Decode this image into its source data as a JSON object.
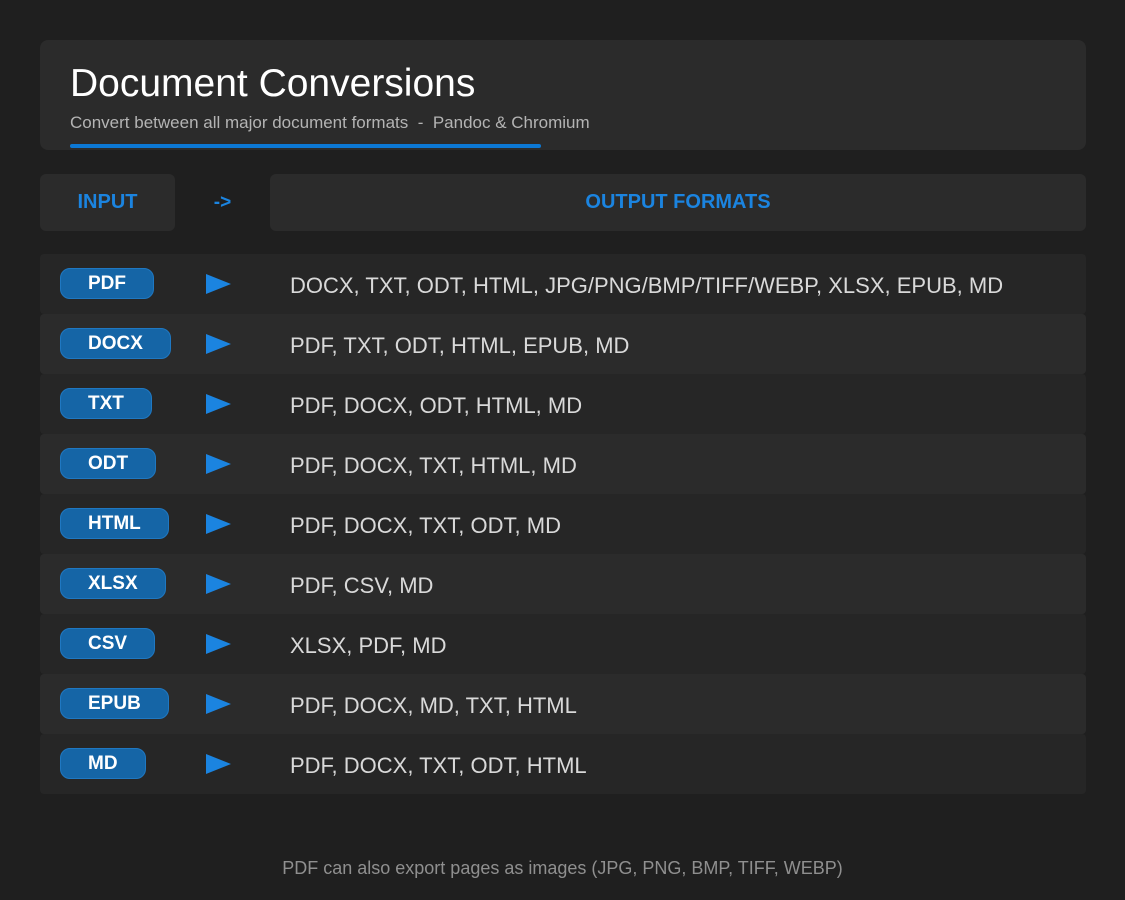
{
  "header": {
    "title": "Document Conversions",
    "subtitle": "Convert between all major document formats  -  Pandoc & Chromium",
    "accent_color": "#0c78d4"
  },
  "table_header": {
    "input_label": "INPUT",
    "arrow_label": "->",
    "output_label": "OUTPUT FORMATS"
  },
  "rows": [
    {
      "input": "PDF",
      "outputs": "DOCX, TXT, ODT, HTML, JPG/PNG/BMP/TIFF/WEBP, XLSX, EPUB, MD",
      "arrow_icon": "play-triangle-icon"
    },
    {
      "input": "DOCX",
      "outputs": "PDF, TXT, ODT, HTML, EPUB, MD",
      "arrow_icon": "play-triangle-icon"
    },
    {
      "input": "TXT",
      "outputs": "PDF, DOCX, ODT, HTML, MD",
      "arrow_icon": "play-triangle-icon"
    },
    {
      "input": "ODT",
      "outputs": "PDF, DOCX, TXT, HTML, MD",
      "arrow_icon": "play-triangle-icon"
    },
    {
      "input": "HTML",
      "outputs": "PDF, DOCX, TXT, ODT, MD",
      "arrow_icon": "play-triangle-icon"
    },
    {
      "input": "XLSX",
      "outputs": "PDF, CSV, MD",
      "arrow_icon": "play-triangle-icon"
    },
    {
      "input": "CSV",
      "outputs": "XLSX, PDF, MD",
      "arrow_icon": "play-triangle-icon"
    },
    {
      "input": "EPUB",
      "outputs": "PDF, DOCX, MD, TXT, HTML",
      "arrow_icon": "play-triangle-icon"
    },
    {
      "input": "MD",
      "outputs": "PDF, DOCX, TXT, ODT, HTML",
      "arrow_icon": "play-triangle-icon"
    }
  ],
  "footer": {
    "note": "PDF can also export pages as images (JPG, PNG, BMP, TIFF, WEBP)"
  },
  "colors": {
    "background": "#1f1f1f",
    "card": "#2b2b2b",
    "badge": "#1565a6",
    "accent_text": "#1b84e0"
  }
}
